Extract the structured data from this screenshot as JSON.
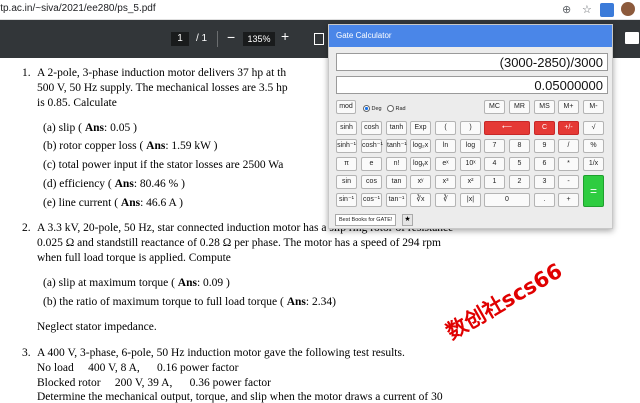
{
  "browser": {
    "url": "itp.ac.in/~siva/2021/ee280/ps_5.pdf"
  },
  "pdf_toolbar": {
    "page": "1",
    "page_total": "/ 1",
    "zoom": "135%"
  },
  "doc": {
    "q1": {
      "num": "1.",
      "line1": "A 2-pole, 3-phase induction motor delivers 37 hp at th",
      "line2": "500 V, 50 Hz supply. The mechanical losses are 3.5 hp",
      "line3": "is 0.85. Calculate",
      "items": [
        {
          "pre": "(a)  slip ( ",
          "ans": "Ans",
          "post": ": 0.05 )"
        },
        {
          "pre": "(b)  rotor copper loss ( ",
          "ans": "Ans",
          "post": ": 1.59 kW )"
        },
        {
          "pre": "(c)  total power input if the stator losses are 2500 Wa",
          "ans": "",
          "post": ""
        },
        {
          "pre": "(d)  efficiency ( ",
          "ans": "Ans",
          "post": ": 80.46 % )"
        },
        {
          "pre": "(e)  line current ( ",
          "ans": "Ans",
          "post": ": 46.6 A )"
        }
      ]
    },
    "q2": {
      "num": "2.",
      "line1": "A 3.3 kV, 20-pole, 50 Hz, star connected induction motor has a slip ring rotor of resistance",
      "line2": "0.025 Ω and standstill reactance of 0.28 Ω per phase. The motor has a speed of 294 rpm",
      "line3": "when full load torque is applied. Compute",
      "items": [
        {
          "pre": "(a)  slip at maximum torque ( ",
          "ans": "Ans",
          "post": ": 0.09 )"
        },
        {
          "pre": "(b)  the ratio of maximum torque to full load torque ( ",
          "ans": "Ans",
          "post": ": 2.34)"
        }
      ],
      "note": "Neglect stator impedance."
    },
    "q3": {
      "num": "3.",
      "line1": "A 400 V, 3-phase, 6-pole, 50 Hz induction motor gave the following test results.",
      "line2": "No load     400 V, 8 A,      0.16 power factor",
      "line3": "Blocked rotor     200 V, 39 A,      0.36 power factor",
      "line4": "Determine the mechanical output, torque, and slip when the motor draws a current of 30"
    }
  },
  "calculator": {
    "title": "Gate Calculator",
    "expression": "(3000-2850)/3000",
    "result": "0.05000000",
    "mod_label": "mod",
    "deg_label": "Deg",
    "rad_label": "Rad",
    "mem": [
      "MC",
      "MR",
      "MS",
      "M+",
      "M-"
    ],
    "row1": [
      "sinh",
      "cosh",
      "tanh",
      "Exp",
      "(",
      ")",
      "⟵",
      "C",
      "+/-",
      "√"
    ],
    "row2": [
      "sinh⁻¹",
      "cosh⁻¹",
      "tanh⁻¹",
      "log₂x",
      "ln",
      "log",
      "7",
      "8",
      "9",
      "/",
      "%"
    ],
    "row3": [
      "π",
      "e",
      "n!",
      "logᵧx",
      "eˣ",
      "10ˣ",
      "4",
      "5",
      "6",
      "*",
      "1/x"
    ],
    "row4": [
      "sin",
      "cos",
      "tan",
      "xʸ",
      "x³",
      "x²",
      "1",
      "2",
      "3",
      "-"
    ],
    "row5": [
      "sin⁻¹",
      "cos⁻¹",
      "tan⁻¹",
      "∛x",
      "∛",
      "|x|",
      "0",
      ".",
      "+"
    ],
    "equals": "=",
    "tab_label": "Best Books for GATE!",
    "star": "★"
  },
  "watermark": "数创社scs66"
}
